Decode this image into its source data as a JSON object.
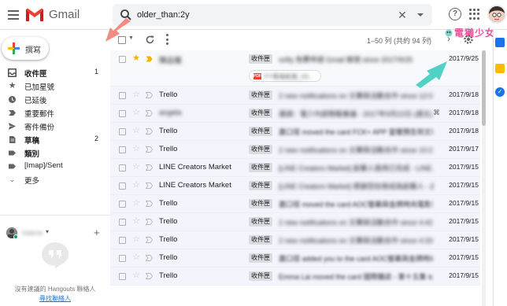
{
  "app": {
    "name": "Gmail"
  },
  "search": {
    "query": "older_than:2y"
  },
  "compose": {
    "label": "撰寫"
  },
  "watermark": {
    "text": "電獺少女"
  },
  "sidebar": {
    "items": [
      {
        "label": "收件匣",
        "count": "1",
        "icon": "inbox-icon",
        "bold": true
      },
      {
        "label": "已加星號",
        "count": "",
        "icon": "star-icon"
      },
      {
        "label": "已延後",
        "count": "",
        "icon": "snooze-clock-icon"
      },
      {
        "label": "重要郵件",
        "count": "",
        "icon": "important-icon"
      },
      {
        "label": "寄件備份",
        "count": "",
        "icon": "send-icon"
      },
      {
        "label": "草稿",
        "count": "2",
        "icon": "draft-icon",
        "bold": true
      },
      {
        "label": "類別",
        "count": "",
        "icon": "label-icon",
        "bold": true
      },
      {
        "label": "[Imap]/Sent",
        "count": "",
        "icon": "label-icon"
      },
      {
        "label": "更多",
        "count": "",
        "icon": "chevron-down-icon"
      }
    ]
  },
  "hangouts": {
    "user_name": "Valerie",
    "empty_text": "沒有建議的 Hangouts 聯絡人",
    "find_link": "尋找聯絡人"
  },
  "toolbar": {
    "pagination": "1–50 列 (共約 94 列)"
  },
  "colors": {
    "accent": "#1a73e8",
    "star": "#f4b400",
    "important": "#f4b400",
    "annotation_arrow": "#f28b82",
    "annotation_arrow_2": "#4fd1c5",
    "watermark": "#e7549c"
  },
  "emails": [
    {
      "starred": true,
      "important": true,
      "sender": "陳品儀",
      "sender_blurred": true,
      "label": "收件匣",
      "snippet": "softy 免費申請 Gmail 帳號 since 2017/9/25",
      "snippet_blurred": true,
      "date": "2017/9/25",
      "attachment": "FY看報紙案_03...",
      "has_clip": false
    },
    {
      "starred": false,
      "important": false,
      "sender": "Trello",
      "label": "收件匣",
      "snippet": "2 new notifications on 文華與活動合作 since 12:03 PM...",
      "snippet_blurred": true,
      "date": "2017/9/18",
      "has_clip": false
    },
    {
      "starred": false,
      "important": false,
      "sender": "angela",
      "sender_blurred": true,
      "label": "收件匣",
      "snippet": "邀請：電少內部簡報會議 - 2017年9月22日 (週五)",
      "snippet_blurred": true,
      "date": "2017/9/18",
      "has_clip": true
    },
    {
      "starred": false,
      "important": false,
      "sender": "Trello",
      "label": "收件匣",
      "snippet": "蕭口瑄 moved the card FCK+ APP 當獵預告到文華",
      "snippet_blurred": false,
      "date": "2017/9/18",
      "has_clip": false
    },
    {
      "starred": false,
      "important": false,
      "sender": "Trello",
      "label": "收件匣",
      "snippet": "2 new notifications on 文華與活動合作 since 10:26 AM",
      "snippet_blurred": true,
      "date": "2017/9/17",
      "has_clip": false
    },
    {
      "starred": false,
      "important": false,
      "sender": "LINE Creators Market",
      "label": "收件匣",
      "snippet": "[LINE Creators Market] 創業人員用已完成 - LINE...",
      "snippet_blurred": true,
      "date": "2017/9/15",
      "has_clip": false
    },
    {
      "starred": false,
      "important": false,
      "sender": "LINE Creators Market",
      "label": "收件匣",
      "snippet": "[LINE Creators Market] 感謝您註冊成為創業人 - 此...",
      "snippet_blurred": true,
      "date": "2017/9/15",
      "has_clip": false
    },
    {
      "starred": false,
      "important": false,
      "sender": "Trello",
      "label": "收件匣",
      "snippet": "蕭口瑄 moved the card AOC螢幕與金牌時尚電影套",
      "snippet_blurred": false,
      "date": "2017/9/15",
      "has_clip": false
    },
    {
      "starred": false,
      "important": false,
      "sender": "Trello",
      "label": "收件匣",
      "snippet": "2 new notifications on 文華與活動合作 since 4:42 PM",
      "snippet_blurred": true,
      "date": "2017/9/15",
      "has_clip": false
    },
    {
      "starred": false,
      "important": false,
      "sender": "Trello",
      "label": "收件匣",
      "snippet": "2 new notifications on 文華與活動合作 since 4:33 PM",
      "snippet_blurred": true,
      "date": "2017/9/15",
      "has_clip": false
    },
    {
      "starred": false,
      "important": false,
      "sender": "Trello",
      "label": "收件匣",
      "snippet": "蕭口瑄 added you to the card AOC螢幕與金牌時尚電影",
      "snippet_blurred": false,
      "date": "2017/9/15",
      "has_clip": false
    },
    {
      "starred": false,
      "important": false,
      "sender": "Trello",
      "label": "收件匣",
      "snippet": "Emma Lai moved the card 國際雜誌 - 第十五集 to 進...",
      "snippet_blurred": false,
      "date": "2017/9/15",
      "has_clip": false
    }
  ]
}
